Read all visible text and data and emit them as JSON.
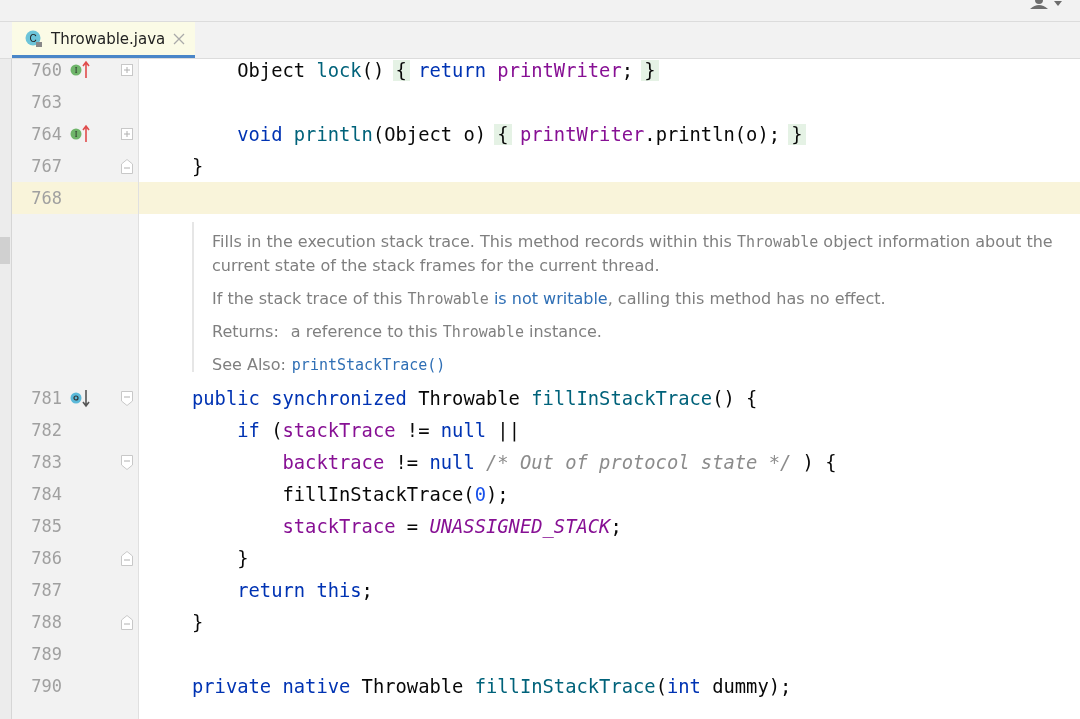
{
  "tab": {
    "label": "Throwable.java",
    "icon_letter": "C",
    "selected": true
  },
  "lines_top": [
    {
      "number": "760",
      "marker": {
        "kind": "implements-up",
        "letter": "I"
      },
      "fold": {
        "kind": "plus"
      },
      "current": false,
      "tokens": [
        {
          "kind": "plain",
          "text": "    Object "
        },
        {
          "kind": "method",
          "text": "lock"
        },
        {
          "kind": "plain",
          "text": "() "
        },
        {
          "kind": "fold",
          "text": "{"
        },
        {
          "kind": "keyword",
          "text": " return"
        },
        {
          "kind": "field",
          "text": " printWriter"
        },
        {
          "kind": "plain",
          "text": "; "
        },
        {
          "kind": "fold",
          "text": "}"
        }
      ]
    },
    {
      "number": "763",
      "current": false
    },
    {
      "number": "764",
      "marker": {
        "kind": "implements-up",
        "letter": "I"
      },
      "fold": {
        "kind": "plus"
      },
      "current": false,
      "tokens": [
        {
          "kind": "keyword",
          "text": "    void"
        },
        {
          "kind": "method",
          "text": " println"
        },
        {
          "kind": "plain",
          "text": "(Object o) "
        },
        {
          "kind": "fold",
          "text": "{"
        },
        {
          "kind": "field",
          "text": " printWriter"
        },
        {
          "kind": "plain",
          "text": ".println(o); "
        },
        {
          "kind": "fold",
          "text": "}"
        }
      ]
    },
    {
      "number": "767",
      "fold": {
        "kind": "end"
      },
      "current": false,
      "tokens": [
        {
          "kind": "plain",
          "text": "}"
        }
      ]
    },
    {
      "number": "768",
      "current": true
    }
  ],
  "doc": {
    "paragraphs": [
      [
        {
          "kind": "text",
          "text": "Fills in the execution stack trace. This method records within this "
        },
        {
          "kind": "code",
          "text": "Throwable"
        },
        {
          "kind": "text",
          "text": " object information about the current state of the stack frames for the current thread."
        }
      ],
      [
        {
          "kind": "text",
          "text": "If the stack trace of this "
        },
        {
          "kind": "code",
          "text": "Throwable"
        },
        {
          "kind": "link",
          "text": " is not writable"
        },
        {
          "kind": "text",
          "text": ", calling this method has no effect."
        }
      ]
    ],
    "returns_label": "Returns:",
    "returns": [
      {
        "kind": "text",
        "text": "a reference to this "
      },
      {
        "kind": "code",
        "text": "Throwable"
      },
      {
        "kind": "text",
        "text": " instance."
      }
    ],
    "see_also_label": "See Also:",
    "see_also_link": "printStackTrace()"
  },
  "lines_bottom": [
    {
      "number": "781",
      "marker": {
        "kind": "overridden-down"
      },
      "fold": {
        "kind": "start"
      },
      "current": false,
      "tokens": [
        {
          "kind": "keyword",
          "text": "public synchronized"
        },
        {
          "kind": "plain",
          "text": " Throwable "
        },
        {
          "kind": "method",
          "text": "fillInStackTrace"
        },
        {
          "kind": "plain",
          "text": "() {"
        }
      ]
    },
    {
      "number": "782",
      "current": false,
      "tokens": [
        {
          "kind": "keyword",
          "text": "    if"
        },
        {
          "kind": "plain",
          "text": " ("
        },
        {
          "kind": "field",
          "text": "stackTrace"
        },
        {
          "kind": "plain",
          "text": " != "
        },
        {
          "kind": "keyword",
          "text": "null"
        },
        {
          "kind": "plain",
          "text": " ||"
        }
      ]
    },
    {
      "number": "783",
      "fold": {
        "kind": "start"
      },
      "current": false,
      "tokens": [
        {
          "kind": "field",
          "text": "        backtrace"
        },
        {
          "kind": "plain",
          "text": " != "
        },
        {
          "kind": "keyword",
          "text": "null"
        },
        {
          "kind": "comment",
          "text": " /* Out of protocol state */"
        },
        {
          "kind": "plain",
          "text": " ) {"
        }
      ]
    },
    {
      "number": "784",
      "current": false,
      "tokens": [
        {
          "kind": "plain",
          "text": "        fillInStackTrace("
        },
        {
          "kind": "number",
          "text": "0"
        },
        {
          "kind": "plain",
          "text": ");"
        }
      ]
    },
    {
      "number": "785",
      "current": false,
      "tokens": [
        {
          "kind": "field",
          "text": "        stackTrace"
        },
        {
          "kind": "plain",
          "text": " = "
        },
        {
          "kind": "constant",
          "text": "UNASSIGNED_STACK"
        },
        {
          "kind": "plain",
          "text": ";"
        }
      ]
    },
    {
      "number": "786",
      "fold": {
        "kind": "end"
      },
      "current": false,
      "tokens": [
        {
          "kind": "plain",
          "text": "    }"
        }
      ]
    },
    {
      "number": "787",
      "current": false,
      "tokens": [
        {
          "kind": "keyword",
          "text": "    return this"
        },
        {
          "kind": "plain",
          "text": ";"
        }
      ]
    },
    {
      "number": "788",
      "fold": {
        "kind": "end"
      },
      "current": false,
      "tokens": [
        {
          "kind": "plain",
          "text": "}"
        }
      ]
    },
    {
      "number": "789",
      "current": false
    },
    {
      "number": "790",
      "current": false,
      "tokens": [
        {
          "kind": "keyword",
          "text": "private native"
        },
        {
          "kind": "plain",
          "text": " Throwable "
        },
        {
          "kind": "method",
          "text": "fillInStackTrace"
        },
        {
          "kind": "plain",
          "text": "("
        },
        {
          "kind": "keyword",
          "text": "int"
        },
        {
          "kind": "plain",
          "text": " dummy);"
        }
      ]
    }
  ]
}
